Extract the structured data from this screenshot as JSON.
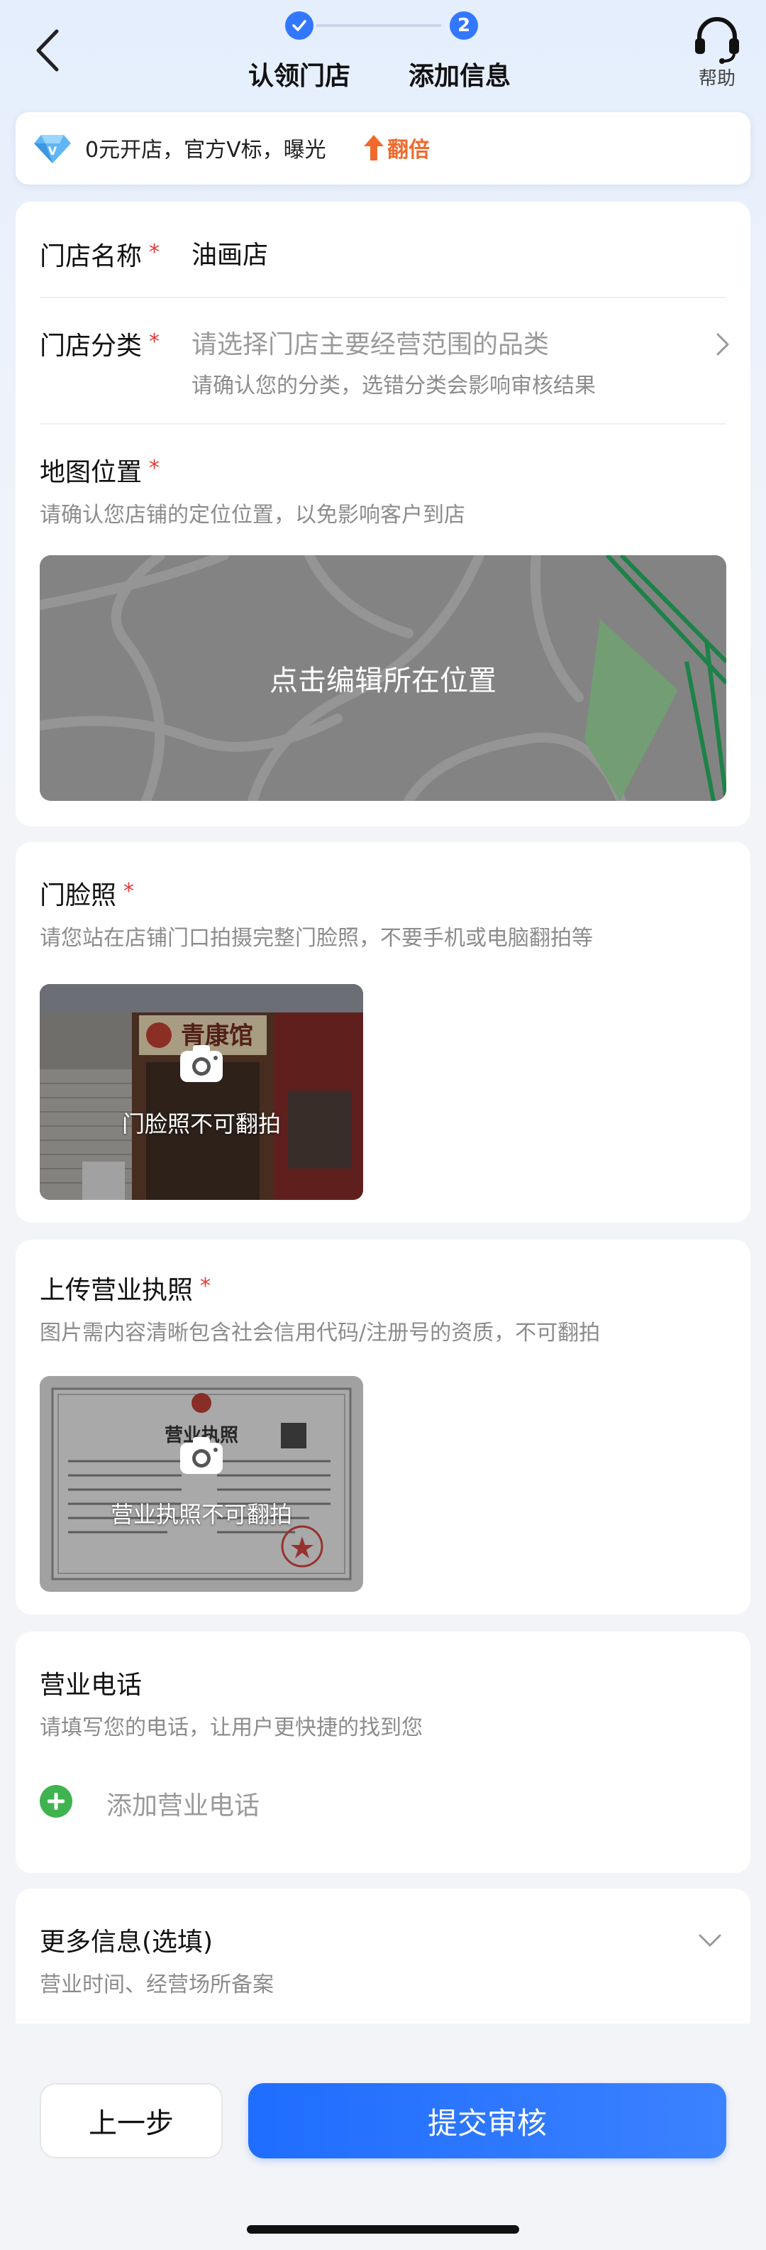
{
  "header": {
    "back_icon": "chevron-left-icon",
    "steps": [
      {
        "label": "认领门店",
        "state": "done",
        "icon": "check-icon"
      },
      {
        "label": "添加信息",
        "state": "current",
        "number": "2"
      }
    ],
    "help_label": "帮助",
    "help_icon": "headset-icon",
    "accent_color": "#3377ff"
  },
  "promo": {
    "icon": "diamond-icon",
    "text": "0元开店，官方V标，曝光",
    "highlight": "翻倍",
    "highlight_icon": "arrow-up-icon",
    "highlight_color": "#f06a2e"
  },
  "basic": {
    "store_name": {
      "label": "门店名称",
      "required": "*",
      "value": "油画店"
    },
    "category": {
      "label": "门店分类",
      "required": "*",
      "placeholder": "请选择门店主要经营范围的品类",
      "hint": "请确认您的分类，选错分类会影响审核结果"
    },
    "map": {
      "label": "地图位置",
      "required": "*",
      "hint": "请确认您店铺的定位位置，以免影响客户到店",
      "action": "点击编辑所在位置"
    }
  },
  "storefront": {
    "label": "门脸照",
    "required": "*",
    "hint": "请您站在店铺门口拍摄完整门脸照，不要手机或电脑翻拍等",
    "caption": "门脸照不可翻拍",
    "sign_text": "青康馆"
  },
  "license": {
    "label": "上传营业执照",
    "required": "*",
    "hint": "图片需内容清晰包含社会信用代码/注册号的资质，不可翻拍",
    "caption": "营业执照不可翻拍",
    "doc_title": "营业执照"
  },
  "phone": {
    "label": "营业电话",
    "hint": "请填写您的电话，让用户更快捷的找到您",
    "add_label": "添加营业电话",
    "add_icon": "plus-circle-icon",
    "add_color": "#3fb34f"
  },
  "more": {
    "label": "更多信息(选填)",
    "hint": "营业时间、经营场所备案"
  },
  "actions": {
    "prev_label": "上一步",
    "submit_label": "提交审核"
  }
}
